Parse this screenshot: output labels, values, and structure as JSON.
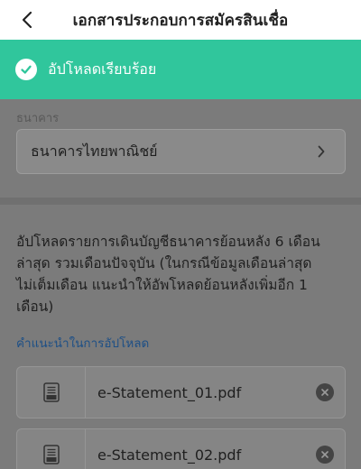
{
  "header": {
    "title": "เอกสารประกอบการสมัครสินเชื่อ"
  },
  "toast": {
    "message": "อัปโหลดเรียบร้อย"
  },
  "bank": {
    "label": "ธนาคาร",
    "selected": "ธนาคารไทยพาณิชย์"
  },
  "instructions": {
    "line1": "อัปโหลดรายการเดินบัญชีธนาคารย้อนหลัง 6 เดือน",
    "line2": "ล่าสุด รวมเดือนปัจจุบัน (ในกรณีข้อมูลเดือนล่าสุด",
    "line3": "ไม่เต็มเดือน แนะนำให้อัพโหลดย้อนหลังเพิ่มอีก 1",
    "line4": "เดือน)",
    "guide_link": "คำแนะนำในการอัปโหลด"
  },
  "files": [
    {
      "name": "e-Statement_01.pdf"
    },
    {
      "name": "e-Statement_02.pdf"
    }
  ],
  "icons": {
    "back": "chevron-left-icon",
    "toast": "check-circle-icon",
    "select": "chevron-right-icon",
    "file": "pdf-file-icon",
    "remove": "close-circle-icon"
  },
  "colors": {
    "toast_bg": "#30c69c",
    "link": "#1d4f86",
    "overlay": "#7b7b7b"
  }
}
